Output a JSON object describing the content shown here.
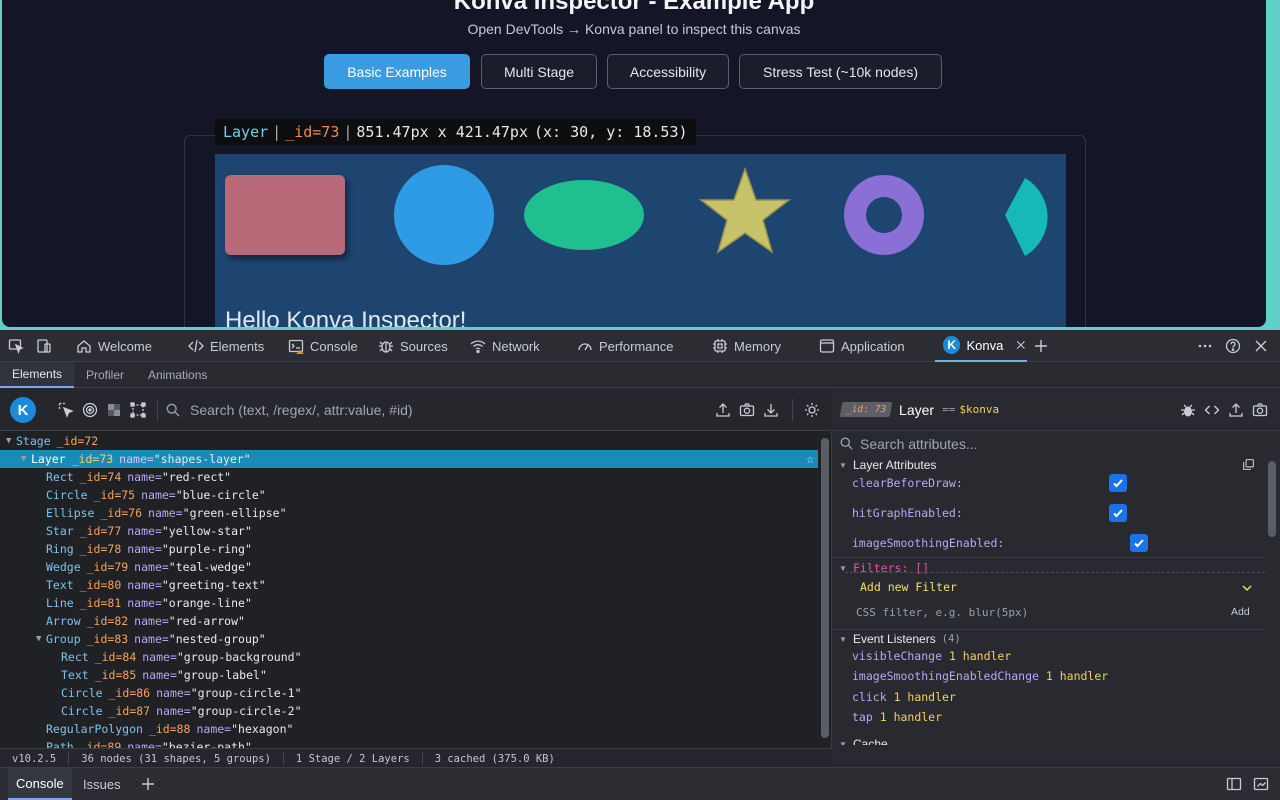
{
  "app": {
    "title": "Konva Inspector - Example App",
    "subtitle": "Open DevTools → Konva panel to inspect this canvas",
    "buttons": [
      "Basic Examples",
      "Multi Stage",
      "Accessibility",
      "Stress Test (~10k nodes)"
    ],
    "active_button": "Basic Examples",
    "tooltip": {
      "name": "Layer",
      "id": "_id=73",
      "size": "851.47px x 421.47px",
      "pos": "(x: 30, y: 18.53)"
    },
    "canvas_text": "Hello Konva Inspector!",
    "shape_colors": {
      "rect": "#b86a78",
      "circle": "#2f9be6",
      "ellipse": "#1fbf8f",
      "star": "#c7c36a",
      "ring": "#8a70d6",
      "wedge": "#17b9b6",
      "canvas_bg": "#1e4470"
    }
  },
  "devtools": {
    "main_tabs": [
      "Welcome",
      "Elements",
      "Console",
      "Sources",
      "Network",
      "Performance",
      "Memory",
      "Application",
      "Konva"
    ],
    "active_main_tab": "Konva",
    "sub_tabs": [
      "Elements",
      "Profiler",
      "Animations"
    ],
    "active_sub_tab": "Elements",
    "search_placeholder": "Search (text, /regex/, attr:value, #id)",
    "tree": [
      {
        "type": "Stage",
        "id": "_id=72",
        "name": ""
      },
      {
        "type": "Layer",
        "id": "_id=73",
        "name": "\"shapes-layer\""
      },
      {
        "type": "Rect",
        "id": "_id=74",
        "name": "\"red-rect\""
      },
      {
        "type": "Circle",
        "id": "_id=75",
        "name": "\"blue-circle\""
      },
      {
        "type": "Ellipse",
        "id": "_id=76",
        "name": "\"green-ellipse\""
      },
      {
        "type": "Star",
        "id": "_id=77",
        "name": "\"yellow-star\""
      },
      {
        "type": "Ring",
        "id": "_id=78",
        "name": "\"purple-ring\""
      },
      {
        "type": "Wedge",
        "id": "_id=79",
        "name": "\"teal-wedge\""
      },
      {
        "type": "Text",
        "id": "_id=80",
        "name": "\"greeting-text\""
      },
      {
        "type": "Line",
        "id": "_id=81",
        "name": "\"orange-line\""
      },
      {
        "type": "Arrow",
        "id": "_id=82",
        "name": "\"red-arrow\""
      },
      {
        "type": "Group",
        "id": "_id=83",
        "name": "\"nested-group\""
      },
      {
        "type": "Rect",
        "id": "_id=84",
        "name": "\"group-background\""
      },
      {
        "type": "Text",
        "id": "_id=85",
        "name": "\"group-label\""
      },
      {
        "type": "Circle",
        "id": "_id=86",
        "name": "\"group-circle-1\""
      },
      {
        "type": "Circle",
        "id": "_id=87",
        "name": "\"group-circle-2\""
      },
      {
        "type": "RegularPolygon",
        "id": "_id=88",
        "name": "\"hexagon\""
      },
      {
        "type": "Path",
        "id": "_id=89",
        "name": "\"bezier-path\""
      }
    ],
    "name_attr_label": "name=",
    "status": [
      "v10.2.5",
      "36 nodes  (31 shapes, 5 groups)",
      "1 Stage / 2 Layers",
      "3 cached (375.0 KB)"
    ],
    "inspector": {
      "id_badge": "_id: 73",
      "node_name": "Layer",
      "eq": "==",
      "var": "$konva",
      "attr_search_placeholder": "Search attributes...",
      "layer_attributes_title": "Layer Attributes",
      "attributes": [
        {
          "label": "clearBeforeDraw:",
          "checked": true
        },
        {
          "label": "hitGraphEnabled:",
          "checked": true
        },
        {
          "label": "imageSmoothingEnabled:",
          "checked": true
        }
      ],
      "filters_title": "Filters: []",
      "add_filter": "Add new Filter",
      "css_filter_placeholder": "CSS filter, e.g. blur(5px)",
      "add_button": "Add",
      "event_listeners_title": "Event Listeners",
      "event_listeners_count": "(4)",
      "listeners": [
        {
          "name": "visibleChange",
          "count": "1 handler"
        },
        {
          "name": "imageSmoothingEnabledChange",
          "count": "1 handler"
        },
        {
          "name": "click",
          "count": "1 handler"
        },
        {
          "name": "tap",
          "count": "1 handler"
        }
      ],
      "cache_title": "Cache"
    },
    "drawer_tabs": [
      "Console",
      "Issues"
    ]
  }
}
